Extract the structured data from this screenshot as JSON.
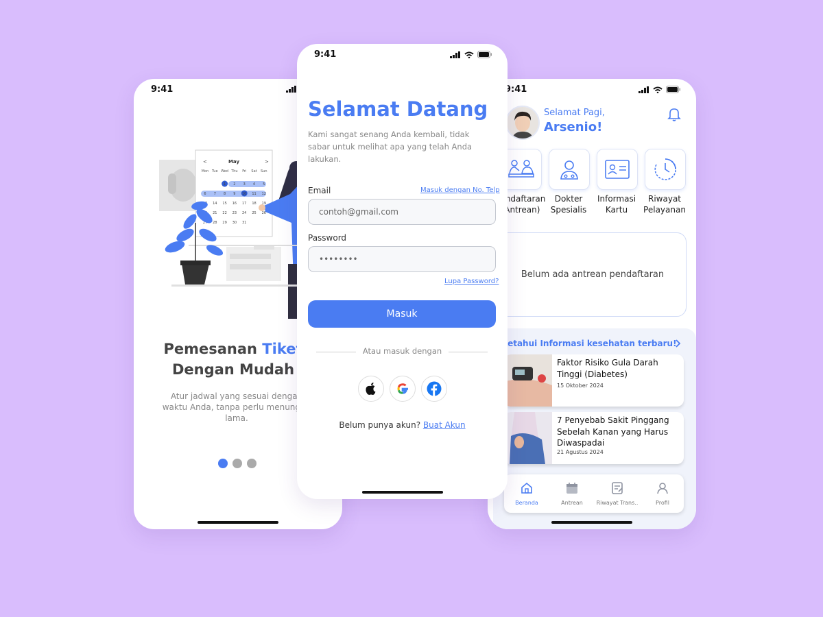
{
  "status": {
    "time": "9:41"
  },
  "onboarding": {
    "title_part1": "Pemesanan ",
    "title_accent": "Tiket",
    "title_line2": "Dengan Mudah",
    "description": "Atur jadwal yang sesuai dengan waktu Anda, tanpa perlu menunggu lama.",
    "calendar": {
      "month": "May",
      "days": [
        "Mon",
        "Tue",
        "Wed",
        "Thu",
        "Fri",
        "Sat",
        "Sun"
      ],
      "rows": [
        [
          "",
          "",
          "1",
          "2",
          "3",
          "4",
          "5"
        ],
        [
          "6",
          "7",
          "8",
          "9",
          "10",
          "11",
          "12"
        ],
        [
          "13",
          "14",
          "15",
          "16",
          "17",
          "18",
          "19"
        ],
        [
          "20",
          "21",
          "22",
          "23",
          "24",
          "25",
          "26"
        ],
        [
          "27",
          "28",
          "29",
          "30",
          "31",
          "",
          ""
        ]
      ]
    },
    "page_indicator": {
      "total": 3,
      "active": 1
    }
  },
  "login": {
    "title": "Selamat Datang",
    "subtitle": "Kami sangat senang Anda kembali, tidak sabar untuk melihat apa yang telah Anda lakukan.",
    "email_label": "Email",
    "phone_login_link": "Masuk dengan No. Telp",
    "email_placeholder": "contoh@gmail.com",
    "password_label": "Password",
    "password_value": "••••••••",
    "forgot_link": "Lupa Password?",
    "submit_label": "Masuk",
    "divider_text": "Atau masuk dengan",
    "social": [
      "apple-icon",
      "google-icon",
      "facebook-icon"
    ],
    "signup_prompt": "Belum punya akun? ",
    "signup_link": "Buat Akun"
  },
  "home": {
    "greeting": "Selamat Pagi,",
    "user_name": "Arsenio!",
    "menu": [
      {
        "label": "Pendaftaran\n(Antrean)",
        "icon": "registration-icon"
      },
      {
        "label": "Dokter\nSpesialis",
        "icon": "doctor-icon"
      },
      {
        "label": "Informasi\nKartu",
        "icon": "id-card-icon"
      },
      {
        "label": "Riwayat\nPelayanan",
        "icon": "history-icon"
      }
    ],
    "queue_empty": "Belum ada antrean pendaftaran",
    "news_heading": "Ketahui Informasi kesehatan terbaru!",
    "news": [
      {
        "title": "Faktor Risiko Gula Darah Tinggi (Diabetes)",
        "date": "15 Oktober 2024"
      },
      {
        "title": "7 Penyebab Sakit Pinggang Sebelah Kanan yang Harus Diwaspadai",
        "date": "21 Agustus 2024"
      }
    ],
    "nav": [
      {
        "label": "Beranda",
        "icon": "home-icon",
        "active": true
      },
      {
        "label": "Antrean",
        "icon": "calendar-icon",
        "active": false
      },
      {
        "label": "Riwayat Trans..",
        "icon": "transaction-icon",
        "active": false
      },
      {
        "label": "Profil",
        "icon": "profile-icon",
        "active": false
      }
    ]
  },
  "colors": {
    "background": "#d9bdfd",
    "accent": "#4a7cf2"
  }
}
